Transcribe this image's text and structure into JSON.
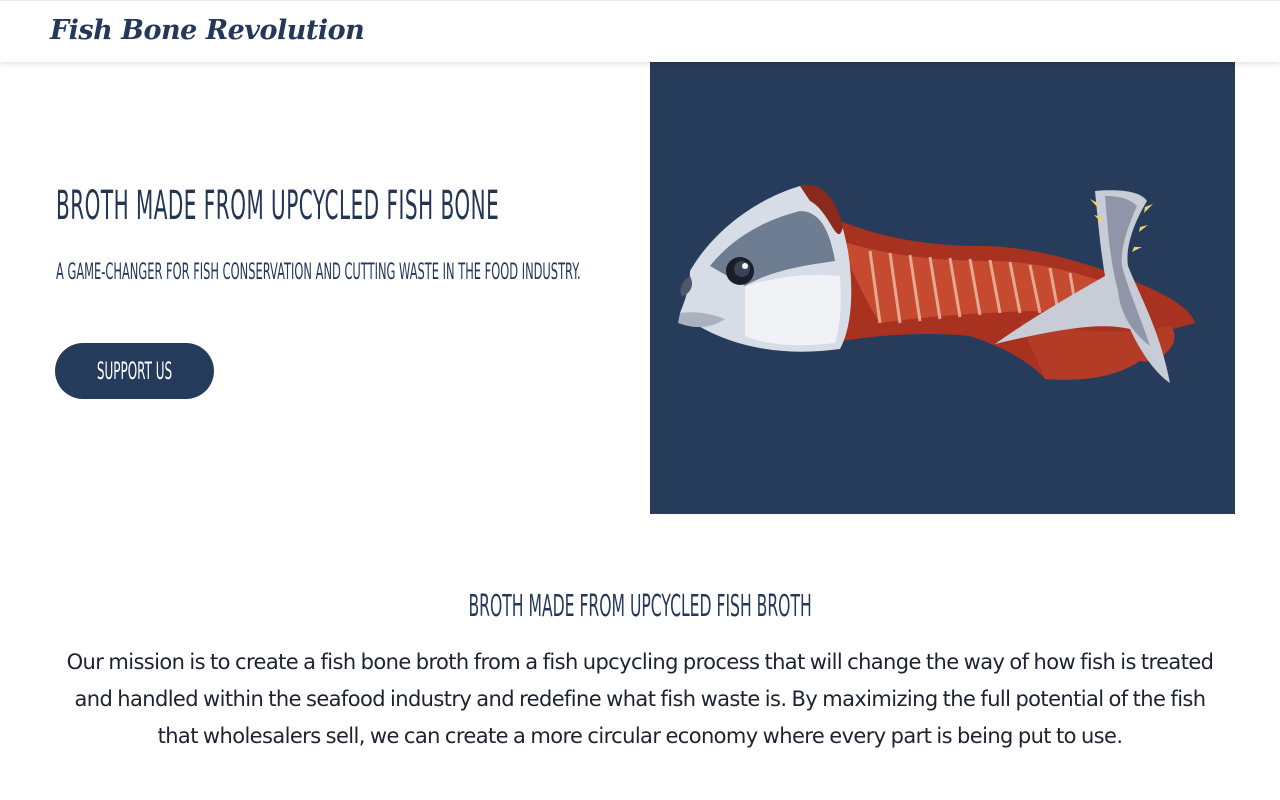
{
  "nav": {
    "brand": "Fish Bone Revolution"
  },
  "hero": {
    "title": "Broth made from upcycled fish bone",
    "subtitle": "A game-changer for fish conservation and cutting waste in the food industry.",
    "cta_label": "Support Us",
    "image_bg_color": "#273b5a"
  },
  "mission": {
    "heading": "Broth made from upcycled fish broth",
    "body": "Our mission is to create a fish bone broth from a fish upcycling process that will change the way of how fish is treated and handled within the seafood industry and redefine what fish waste is. By maximizing the full potential of the fish that wholesalers sell, we can create a more circular economy where every part is being put to use."
  },
  "colors": {
    "primary": "#24385a",
    "text": "#1c2230",
    "background": "#ffffff"
  }
}
